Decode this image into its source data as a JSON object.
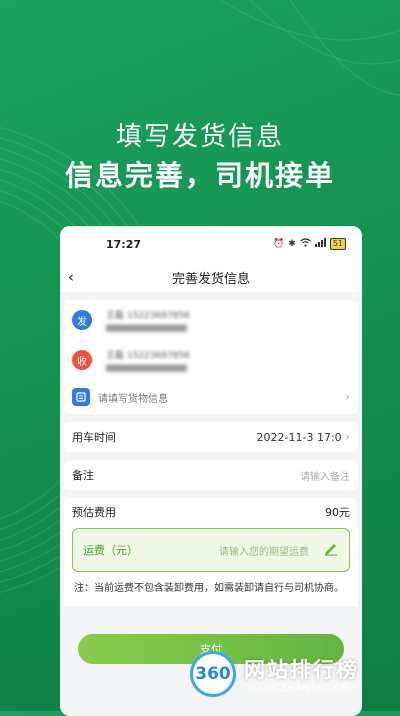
{
  "promo": {
    "line1": "填写发货信息",
    "line2": "信息完善，司机接单"
  },
  "status_bar": {
    "time": "17:27",
    "icons": [
      "alarm-icon",
      "bluetooth-icon",
      "wifi-icon",
      "signal-icon"
    ],
    "battery": "51"
  },
  "nav": {
    "back_icon": "back-chevron-icon",
    "title": "完善发货信息"
  },
  "addresses": {
    "sender": {
      "badge": "发",
      "badge_color": "#2f7ae5",
      "phone": "王磊 15223697856"
    },
    "receiver": {
      "badge": "收",
      "badge_color": "#e8553e",
      "phone": "王磊 15223697856"
    }
  },
  "goods": {
    "placeholder": "请填写货物信息"
  },
  "vehicle_time": {
    "label": "用车时间",
    "value": "2022-11-3 17:0"
  },
  "remark": {
    "label": "备注",
    "placeholder": "请输入备注"
  },
  "estimate": {
    "label": "预估费用",
    "value": "90元"
  },
  "freight": {
    "label": "运费（元）",
    "placeholder": "请输入您的期望运费"
  },
  "notice": "注：当前运费不包含装卸费用，如需装卸请自行与司机协商。",
  "pay_button": "支付",
  "watermark": {
    "logo": "360",
    "title": "网站排行榜",
    "subtitle": "-WANGZHAN360.CN-"
  },
  "colors": {
    "background": "#15924f",
    "accent_green": "#62b542"
  }
}
